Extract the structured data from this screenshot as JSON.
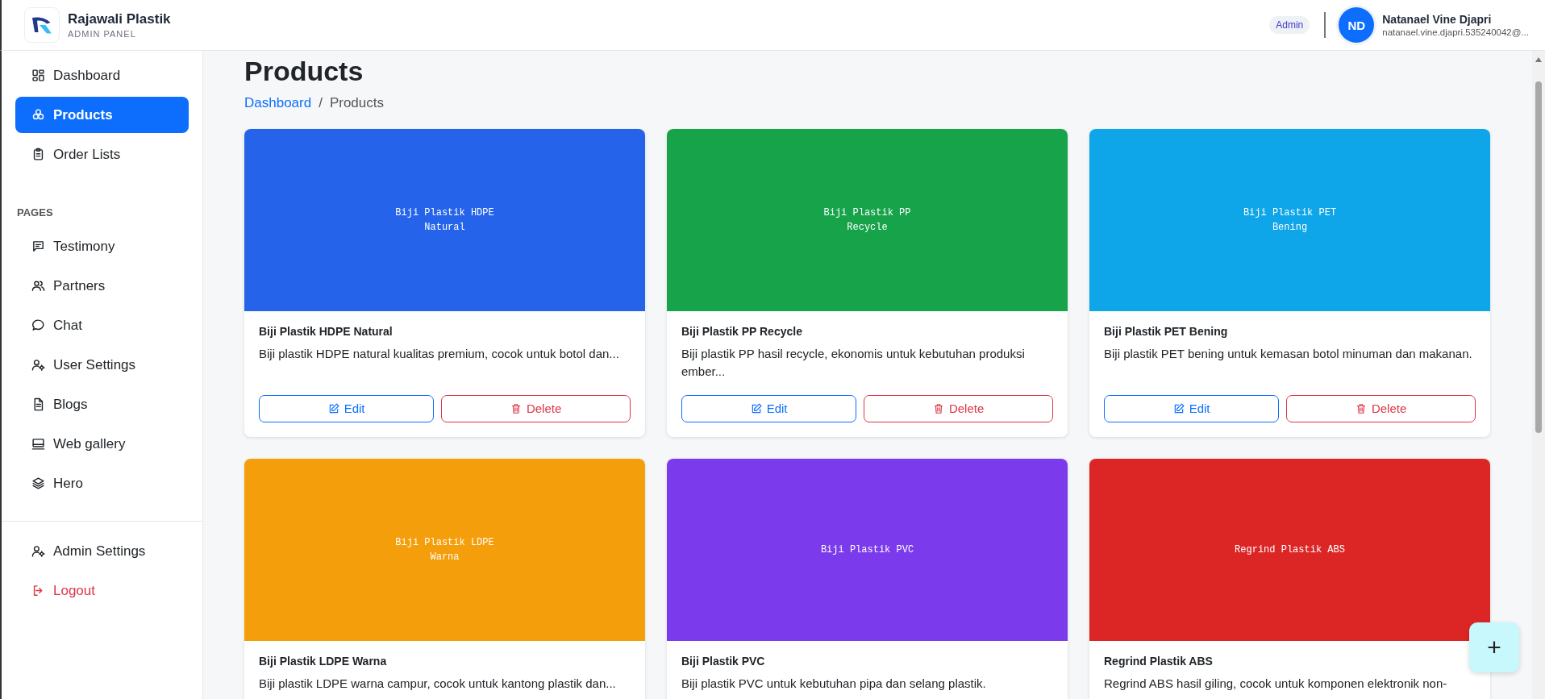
{
  "brand": {
    "name": "Rajawali Plastik",
    "subtitle": "ADMIN PANEL"
  },
  "user": {
    "role": "Admin",
    "initials": "ND",
    "name": "Natanael Vine Djapri",
    "email": "natanael.vine.djapri.535240042@..."
  },
  "sidebar": {
    "main_items": [
      {
        "label": "Dashboard",
        "kind": "dashboard",
        "selected": false
      },
      {
        "label": "Products",
        "kind": "products",
        "selected": true
      },
      {
        "label": "Order Lists",
        "kind": "clipboard",
        "selected": false
      }
    ],
    "sections": [
      {
        "heading": "PAGES",
        "items": [
          {
            "label": "Testimony",
            "kind": "message",
            "selected": false
          },
          {
            "label": "Partners",
            "kind": "people",
            "selected": false
          },
          {
            "label": "Chat",
            "kind": "chat",
            "selected": false
          },
          {
            "label": "User Settings",
            "kind": "usergear",
            "selected": false
          },
          {
            "label": "Blogs",
            "kind": "document",
            "selected": false
          },
          {
            "label": "Web gallery",
            "kind": "monitor",
            "selected": false
          },
          {
            "label": "Hero",
            "kind": "layers",
            "selected": false
          }
        ]
      }
    ],
    "footer_items": [
      {
        "label": "Admin Settings",
        "kind": "usergear"
      },
      {
        "label": "Logout",
        "kind": "logout"
      }
    ]
  },
  "page": {
    "title": "Products",
    "breadcrumb": [
      {
        "label": "Dashboard",
        "kind": "link"
      },
      {
        "label": "Products",
        "kind": "current"
      }
    ],
    "breadcrumb_separator": "/"
  },
  "products": [
    {
      "image_lines": [
        "Biji Plastik HDPE",
        "Natural"
      ],
      "color": "#2563eb",
      "name": "Biji Plastik HDPE Natural",
      "description": "Biji plastik HDPE natural kualitas premium, cocok untuk botol dan...",
      "actions": [
        {
          "label": "Edit",
          "kind": "edit"
        },
        {
          "label": "Delete",
          "kind": "delete"
        }
      ]
    },
    {
      "image_lines": [
        "Biji Plastik PP",
        "Recycle"
      ],
      "color": "#16a34a",
      "name": "Biji Plastik PP Recycle",
      "description": "Biji plastik PP hasil recycle, ekonomis untuk kebutuhan produksi ember...",
      "actions": [
        {
          "label": "Edit",
          "kind": "edit"
        },
        {
          "label": "Delete",
          "kind": "delete"
        }
      ]
    },
    {
      "image_lines": [
        "Biji Plastik PET",
        "Bening"
      ],
      "color": "#0ea5e9",
      "name": "Biji Plastik PET Bening",
      "description": "Biji plastik PET bening untuk kemasan botol minuman dan makanan.",
      "actions": [
        {
          "label": "Edit",
          "kind": "edit"
        },
        {
          "label": "Delete",
          "kind": "delete"
        }
      ]
    },
    {
      "image_lines": [
        "Biji Plastik LDPE",
        "Warna"
      ],
      "color": "#f59e0b",
      "name": "Biji Plastik LDPE Warna",
      "description": "Biji plastik LDPE warna campur, cocok untuk kantong plastik dan..."
    },
    {
      "image_lines": [
        "Biji Plastik PVC"
      ],
      "color": "#7c3aed",
      "name": "Biji Plastik PVC",
      "description": "Biji plastik PVC untuk kebutuhan pipa dan selang plastik."
    },
    {
      "image_lines": [
        "Regrind Plastik ABS"
      ],
      "color": "#dc2626",
      "name": "Regrind Plastik ABS",
      "description": "Regrind ABS hasil giling, cocok untuk komponen elektronik non-"
    }
  ],
  "fab": {
    "label": "+"
  }
}
